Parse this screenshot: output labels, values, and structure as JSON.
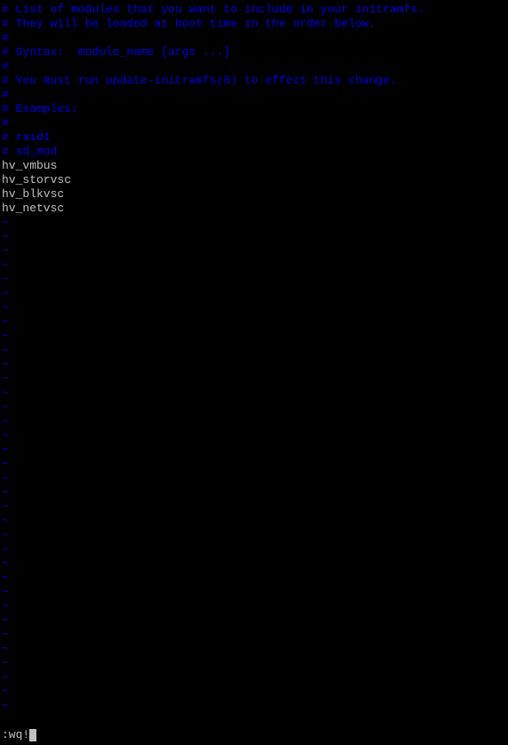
{
  "comments": [
    "# List of modules that you want to include in your initramfs.",
    "# They will be loaded at boot time in the order below.",
    "#",
    "# Syntax:  module_name [args ...]",
    "#",
    "# You must run update-initramfs(8) to effect this change.",
    "#",
    "# Examples:",
    "#",
    "# raid1",
    "# sd_mod"
  ],
  "modules": [
    "hv_vmbus",
    "hv_storvsc",
    "hv_blkvsc",
    "hv_netvsc"
  ],
  "tilde": "~",
  "command": ":wq!"
}
